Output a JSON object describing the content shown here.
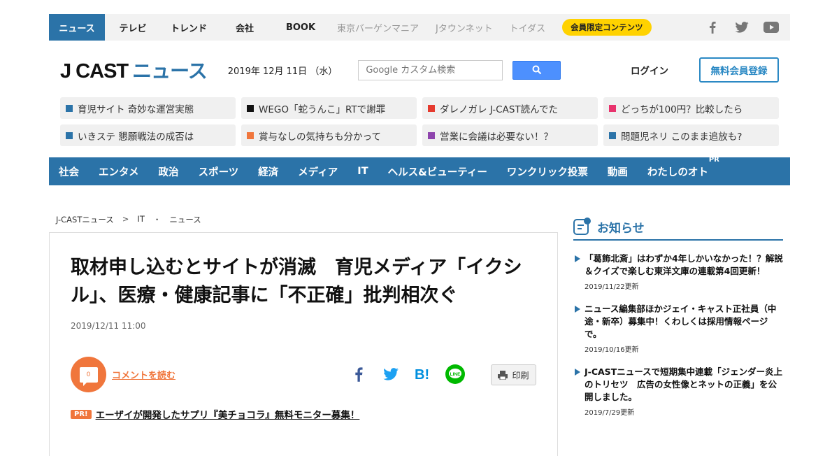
{
  "topbar": {
    "items": [
      {
        "label": "ニュース",
        "style": "active"
      },
      {
        "label": "テレビ",
        "style": "plain"
      },
      {
        "label": "トレンド",
        "style": "plain"
      },
      {
        "label": "会社",
        "style": "plain"
      },
      {
        "label": "BOOK",
        "style": "book"
      },
      {
        "label": "東京バーゲンマニア",
        "style": "gray"
      },
      {
        "label": "Jタウンネット",
        "style": "gray"
      },
      {
        "label": "トイダス",
        "style": "gray"
      }
    ],
    "member_pill": "会員限定コンテンツ",
    "social": [
      "facebook-icon",
      "twitter-icon",
      "youtube-icon"
    ]
  },
  "header": {
    "logo_main": "J CAST",
    "logo_news": "ニュース",
    "date": "2019年 12月 11日 （水）",
    "search_placeholder": "Google カスタム検索",
    "login": "ログイン",
    "register": "無料会員登録"
  },
  "chips": [
    {
      "text": "育児サイト 奇妙な運営実態",
      "color": "#2b73a8"
    },
    {
      "text": "WEGO「蛇うんこ」RTで謝罪",
      "color": "#111111"
    },
    {
      "text": "ダレノガレ J-CAST読んでた",
      "color": "#e53a2e"
    },
    {
      "text": "どっちが100円？比較したら",
      "color": "#e8336d"
    },
    {
      "text": "いきステ 懇願戦法の成否は",
      "color": "#2b73a8"
    },
    {
      "text": "賞与なしの気持ちも分かって",
      "color": "#f0763c"
    },
    {
      "text": "営業に会議は必要ない！？",
      "color": "#8e44ad"
    },
    {
      "text": "問題児ネリ このまま追放も?",
      "color": "#2b73a8"
    }
  ],
  "categories": [
    "社会",
    "エンタメ",
    "政治",
    "スポーツ",
    "経済",
    "メディア",
    "IT",
    "ヘルス&ビューティー",
    "ワンクリック投票",
    "動画",
    "わたしのオト"
  ],
  "category_pr_mark": "PR",
  "breadcrumb": {
    "home": "J-CASTニュース",
    "sep1": ">",
    "section": "IT",
    "sep2": "・",
    "leaf": "ニュース"
  },
  "article": {
    "title": "取材申し込むとサイトが消滅　育児メディア「イクシル」、医療・健康記事に「不正確」批判相次ぐ",
    "timestamp": "2019/12/11 11:00",
    "comment_count": "0",
    "comment_link": "コメントを読む",
    "print": "印刷",
    "pr_badge": "PR!",
    "pr_text": "エーザイが開発したサプリ『美チョコラ』無料モニター募集！"
  },
  "notices": {
    "title": "お知らせ",
    "items": [
      {
        "text": "「葛飾北斎」はわずか4年しかいなかった！？解説＆クイズで楽しむ東洋文庫の連載第4回更新！",
        "date": "2019/11/22更新"
      },
      {
        "text": "ニュース編集部ほかジェイ・キャスト正社員（中途・新卒）募集中！くわしくは採用情報ページで。",
        "date": "2019/10/16更新"
      },
      {
        "text": "J-CASTニュースで短期集中連載「ジェンダー炎上のトリセツ　広告の女性像とネットの正義」を公開しました。",
        "date": "2019/7/29更新"
      }
    ]
  }
}
